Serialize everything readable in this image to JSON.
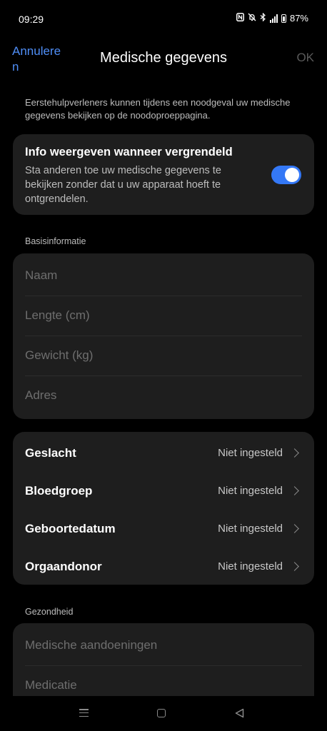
{
  "status_bar": {
    "time": "09:29",
    "battery": "87%",
    "icons": [
      "nfc-icon",
      "mute-icon",
      "bluetooth-icon",
      "signal-4g-icon",
      "battery-icon"
    ]
  },
  "header": {
    "cancel_label": "Annuleren",
    "title": "Medische gegevens",
    "ok_label": "OK"
  },
  "intro_note": "Eerstehulpverleners kunnen tijdens een noodgeval uw medische gegevens bekijken op de noodoproeppagina.",
  "lock_screen": {
    "title": "Info weergeven wanneer vergrendeld",
    "description": "Sta anderen toe uw medische gegevens te bekijken zonder dat u uw apparaat hoeft te ontgrendelen.",
    "enabled": true
  },
  "basic_info": {
    "label": "Basisinformatie",
    "fields": [
      {
        "placeholder": "Naam"
      },
      {
        "placeholder": "Lengte (cm)"
      },
      {
        "placeholder": "Gewicht (kg)"
      },
      {
        "placeholder": "Adres"
      }
    ]
  },
  "details": [
    {
      "label": "Geslacht",
      "value": "Niet ingesteld"
    },
    {
      "label": "Bloedgroep",
      "value": "Niet ingesteld"
    },
    {
      "label": "Geboortedatum",
      "value": "Niet ingesteld"
    },
    {
      "label": "Orgaandonor",
      "value": "Niet ingesteld"
    }
  ],
  "health": {
    "label": "Gezondheid",
    "fields": [
      {
        "placeholder": "Medische aandoeningen"
      },
      {
        "placeholder": "Medicatie"
      }
    ]
  },
  "colors": {
    "accent": "#3478f6",
    "link": "#4f8ef7",
    "card": "#1e1e1e",
    "background": "#000000"
  }
}
